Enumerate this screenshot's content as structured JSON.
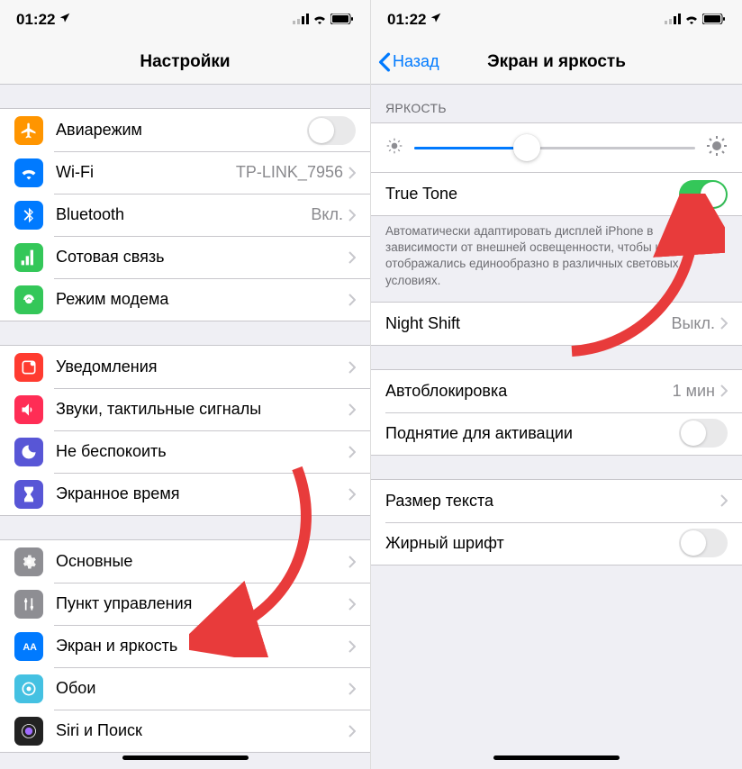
{
  "status": {
    "time": "01:22"
  },
  "left": {
    "title": "Настройки",
    "groups": [
      [
        {
          "icon": "airplane",
          "color": "#ff9500",
          "label": "Авиарежим",
          "toggle": false
        },
        {
          "icon": "wifi",
          "color": "#007aff",
          "label": "Wi-Fi",
          "value": "TP-LINK_7956"
        },
        {
          "icon": "bluetooth",
          "color": "#007aff",
          "label": "Bluetooth",
          "value": "Вкл."
        },
        {
          "icon": "cellular",
          "color": "#34c759",
          "label": "Сотовая связь"
        },
        {
          "icon": "hotspot",
          "color": "#34c759",
          "label": "Режим модема"
        }
      ],
      [
        {
          "icon": "notifications",
          "color": "#ff3b30",
          "label": "Уведомления"
        },
        {
          "icon": "sounds",
          "color": "#ff2d55",
          "label": "Звуки, тактильные сигналы"
        },
        {
          "icon": "dnd",
          "color": "#5856d6",
          "label": "Не беспокоить"
        },
        {
          "icon": "screentime",
          "color": "#5856d6",
          "label": "Экранное время"
        }
      ],
      [
        {
          "icon": "general",
          "color": "#8e8e93",
          "label": "Основные"
        },
        {
          "icon": "control",
          "color": "#8e8e93",
          "label": "Пункт управления"
        },
        {
          "icon": "display",
          "color": "#007aff",
          "label": "Экран и яркость"
        },
        {
          "icon": "wallpaper",
          "color": "#44c1e2",
          "label": "Обои"
        },
        {
          "icon": "siri",
          "color": "#222",
          "label": "Siri и Поиск"
        }
      ]
    ]
  },
  "right": {
    "back": "Назад",
    "title": "Экран и яркость",
    "brightness_header": "ЯРКОСТЬ",
    "brightness_value": 40,
    "truetone": {
      "label": "True Tone",
      "on": true
    },
    "truetone_desc": "Автоматически адаптировать дисплей iPhone в зависимости от внешней освещенности, чтобы цвета отображались единообразно в различных световых условиях.",
    "nightshift": {
      "label": "Night Shift",
      "value": "Выкл."
    },
    "autolock": {
      "label": "Автоблокировка",
      "value": "1 мин"
    },
    "raise": {
      "label": "Поднятие для активации",
      "on": false
    },
    "textsize": {
      "label": "Размер текста"
    },
    "bold": {
      "label": "Жирный шрифт",
      "on": false
    }
  }
}
